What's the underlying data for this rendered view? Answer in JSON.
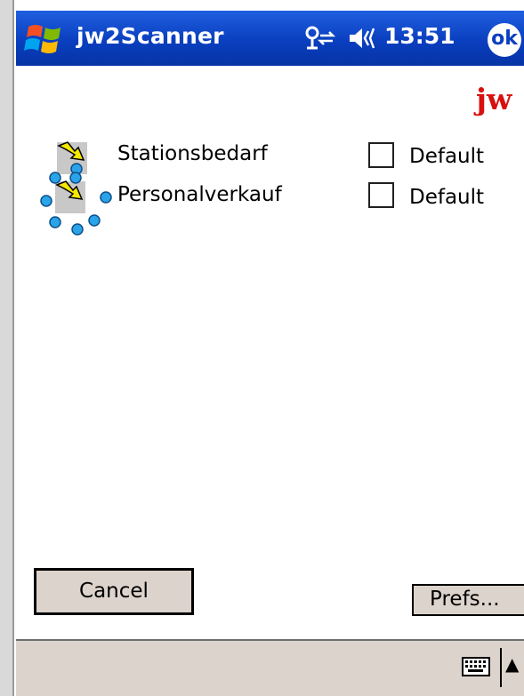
{
  "titlebar": {
    "app_title": "jw2Scanner",
    "clock": "13:51",
    "ok_label": "ok",
    "start_icon": "windows-flag-icon",
    "connectivity_icon": "connectivity-icon",
    "speaker_icon": "speaker-icon"
  },
  "brand": {
    "text": "jw"
  },
  "profiles": [
    {
      "name": "Stationsbedarf",
      "checkbox_label": "Default",
      "checked": false,
      "selected": false
    },
    {
      "name": "Personalverkauf",
      "checkbox_label": "Default",
      "checked": false,
      "selected": true
    }
  ],
  "buttons": {
    "cancel": "Cancel",
    "prefs": "Prefs..."
  },
  "menubar": {
    "keyboard_icon": "keyboard-icon",
    "sip_arrow": "▲"
  },
  "colors": {
    "titlebar": "#0a3fbf",
    "brand": "#d81010",
    "button_face": "#dcd3cc",
    "selection_handle": "#2aa3e8",
    "profile_icon": "#f5e800"
  }
}
